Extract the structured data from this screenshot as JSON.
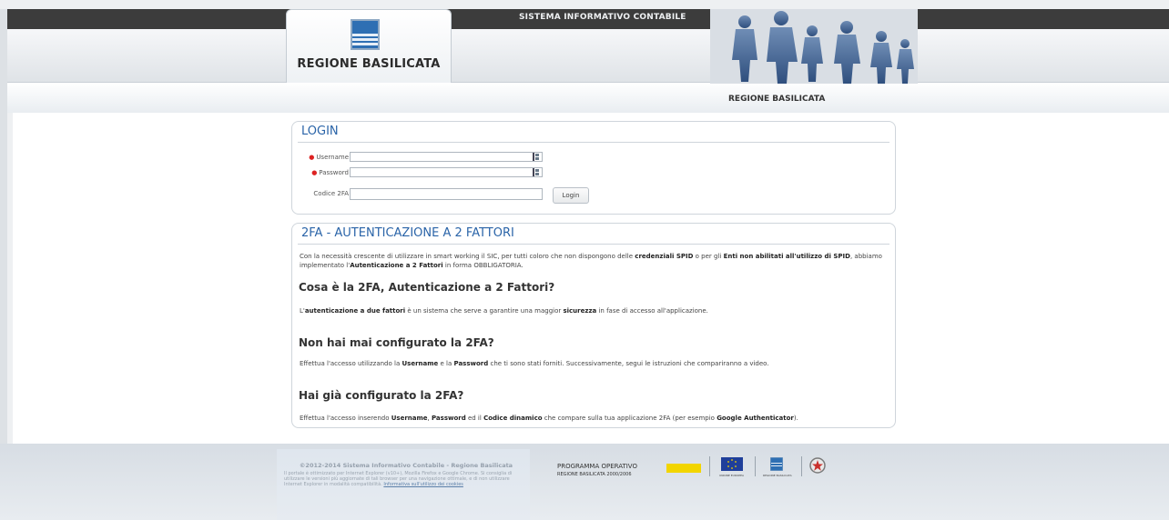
{
  "header": {
    "logo_text": "REGIONE BASILICATA",
    "system_title": "SISTEMA INFORMATIVO CONTABILE",
    "region_label": "REGIONE BASILICATA"
  },
  "login": {
    "title": "LOGIN",
    "username_label": "Username",
    "password_label": "Password",
    "codice_label": "Codice 2FA",
    "username_value": "",
    "password_value": "",
    "codice_value": "",
    "login_button": "Login"
  },
  "info": {
    "title": "2FA - AUTENTICAZIONE A 2 FATTORI",
    "intro_1": "Con la necessità crescente di utilizzare in smart working il SIC, per tutti coloro che non dispongono delle ",
    "intro_b1": "credenziali SPID",
    "intro_2": " o per gli ",
    "intro_b2": "Enti non abilitati all'utilizzo di SPID",
    "intro_3": ", abbiamo implementato l'",
    "intro_b3": "Autenticazione a 2 Fattori",
    "intro_4": " in forma OBBLIGATORIA.",
    "heading_1": "Cosa è la 2FA, Autenticazione a 2 Fattori?",
    "p1_1": "L'",
    "p1_b1": "autenticazione a due fattori",
    "p1_2": " è un sistema che serve a garantire una maggior ",
    "p1_b2": "sicurezza",
    "p1_3": " in fase di accesso all'applicazione.",
    "heading_2": "Non hai mai configurato la 2FA?",
    "p2_1": "Effettua l'accesso utilizzando la ",
    "p2_b1": "Username",
    "p2_2": " e la ",
    "p2_b2": "Password",
    "p2_3": " che ti sono stati forniti. Successivamente, segui le istruzioni che compariranno a video.",
    "heading_3": "Hai già configurato la 2FA?",
    "p3_1": "Effettua l'accesso inserendo ",
    "p3_b1": "Username",
    "p3_2": ", ",
    "p3_b2": "Password",
    "p3_3": " ed il ",
    "p3_b3": "Codice dinamico",
    "p3_4": " che compare sulla tua applicazione 2FA (per esempio ",
    "p3_b4": "Google Authenticator",
    "p3_5": ")."
  },
  "footer": {
    "copyright": "©2012-2014 Sistema Informativo Contabile - Regione Basilicata",
    "browser_note": "Il portale è ottimizzato per Internet Explorer (v10+), Mozilla Firefox e Google Chrome. Si consiglia di utilizzare le versioni più aggiornate di tali browser per una navigazione ottimale, e di non utilizzare Internet Explorer in modalità compatibilità.",
    "cookie_link": "Informativa sull'utilizzo dei cookies",
    "programma_title": "PROGRAMMA OPERATIVO",
    "programma_sub": "REGIONE BASILICATA 2000/2006",
    "ue_label": "UNIONE EUROPEA",
    "rb_label": "REGIONE BASILICATA"
  },
  "colors": {
    "accent_blue": "#2a64a8",
    "required_red": "#dd2222",
    "top_bar": "#3c3c3c"
  },
  "icons": [
    "key-icon",
    "region-emblem",
    "eu-flag",
    "italian-republic-emblem"
  ]
}
